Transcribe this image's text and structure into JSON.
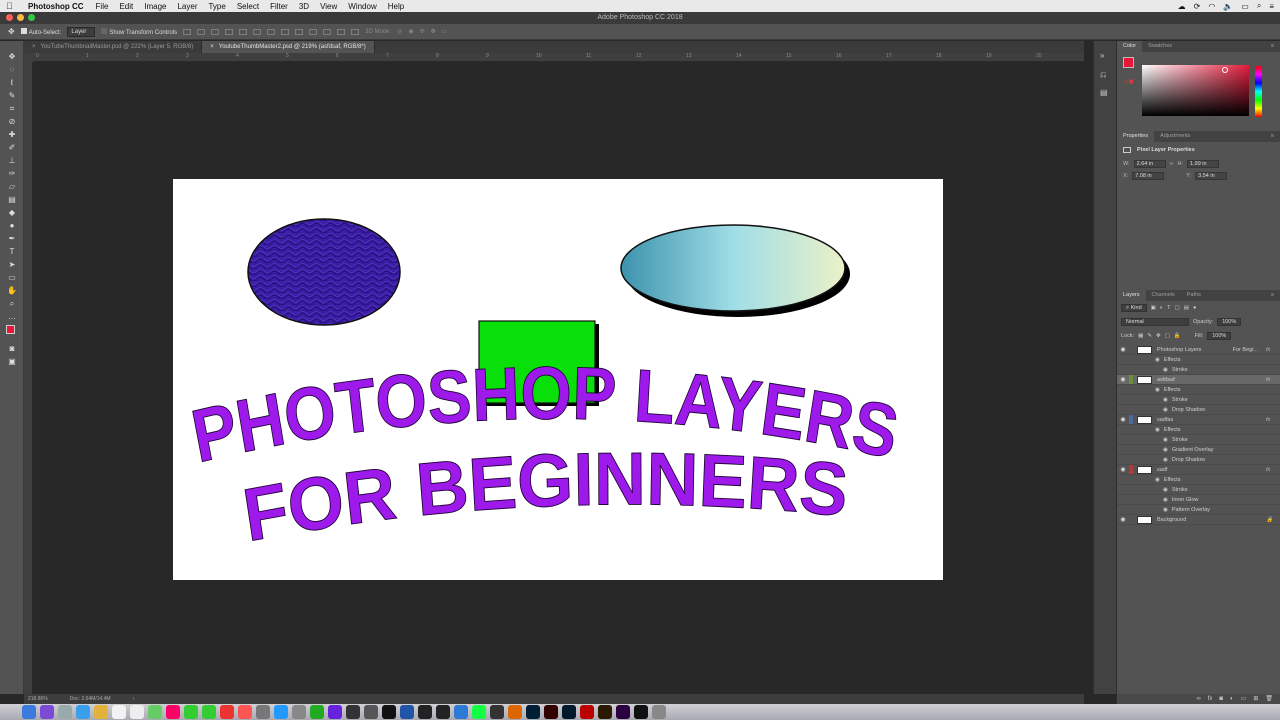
{
  "menubar": {
    "apple": "",
    "app": "Photoshop CC",
    "items": [
      "File",
      "Edit",
      "Image",
      "Layer",
      "Type",
      "Select",
      "Filter",
      "3D",
      "View",
      "Window",
      "Help"
    ]
  },
  "window": {
    "title": "Adobe Photoshop CC 2018"
  },
  "options": {
    "auto_select_label": "Auto-Select:",
    "auto_select_value": "Layer",
    "transform_label": "Show Transform Controls",
    "mode_3d": "3D Mode:"
  },
  "tabs": [
    {
      "label": "YouTubeThumbnailMaster.psd @ 222% (Layer 5, RGB/8)",
      "active": false
    },
    {
      "label": "YoutubeThumbMaster2.psd @ 219% (asfdsaf, RGB/8*)",
      "active": true
    }
  ],
  "ruler": {
    "ticks": [
      "0",
      "1",
      "2",
      "3",
      "4",
      "5",
      "6",
      "7",
      "8",
      "9",
      "10",
      "11",
      "12",
      "13",
      "14",
      "15",
      "16",
      "17",
      "18",
      "19",
      "20"
    ]
  },
  "canvas": {
    "line1": "PHOTOSHOP LAYERS",
    "line2": "FOR BEGINNERS",
    "colors": {
      "text": "#9d1aea",
      "rect": "#09e00a",
      "ellipse1": "#3b1ea6",
      "grad_start": "#3c93ad",
      "grad_mid": "#9fdde6",
      "grad_end": "#ecf1c8"
    }
  },
  "status": {
    "zoom": "218.86%",
    "doc": "Doc: 2.64M/14.4M"
  },
  "color_panel": {
    "tab_color": "Color",
    "tab_swatches": "Swatches",
    "fg": "#e8173a",
    "bg": "#111111"
  },
  "properties": {
    "tab_props": "Properties",
    "tab_adjust": "Adjustments",
    "header": "Pixel Layer Properties",
    "w_label": "W:",
    "w": "2.64 in",
    "h_label": "H:",
    "h": "1.99 in",
    "x_label": "X:",
    "x": "7.08 in",
    "y_label": "Y:",
    "y": "3.54 in"
  },
  "layers_panel": {
    "tab_layers": "Layers",
    "tab_channels": "Channels",
    "tab_paths": "Paths",
    "kind": "Kind",
    "blend": "Normal",
    "opacity_label": "Opacity:",
    "opacity": "100%",
    "lock_label": "Lock:",
    "fill_label": "Fill:",
    "fill": "100%",
    "rows": [
      {
        "type": "layer",
        "name": "Photoshop Layers",
        "extra": "For Begi...",
        "fx": "fx",
        "color": "",
        "selected": false
      },
      {
        "type": "effects",
        "name": "Effects"
      },
      {
        "type": "effect",
        "name": "Stroke"
      },
      {
        "type": "layer",
        "name": "asfdsaf",
        "fx": "fx",
        "color": "#6d8f3b",
        "selected": true
      },
      {
        "type": "effects",
        "name": "Effects"
      },
      {
        "type": "effect",
        "name": "Stroke"
      },
      {
        "type": "effect",
        "name": "Drop Shadow"
      },
      {
        "type": "layer",
        "name": "sadfas",
        "fx": "fx",
        "color": "#4c6a9b",
        "selected": false
      },
      {
        "type": "effects",
        "name": "Effects"
      },
      {
        "type": "effect",
        "name": "Stroke"
      },
      {
        "type": "effect",
        "name": "Gradient Overlay"
      },
      {
        "type": "effect",
        "name": "Drop Shadow"
      },
      {
        "type": "layer",
        "name": "sadf",
        "fx": "fx",
        "color": "#b33a3a",
        "selected": false
      },
      {
        "type": "effects",
        "name": "Effects"
      },
      {
        "type": "effect",
        "name": "Stroke"
      },
      {
        "type": "effect",
        "name": "Inner Glow"
      },
      {
        "type": "effect",
        "name": "Pattern Overlay"
      },
      {
        "type": "layer",
        "name": "Background",
        "fx": "",
        "color": "",
        "selected": false
      }
    ]
  }
}
